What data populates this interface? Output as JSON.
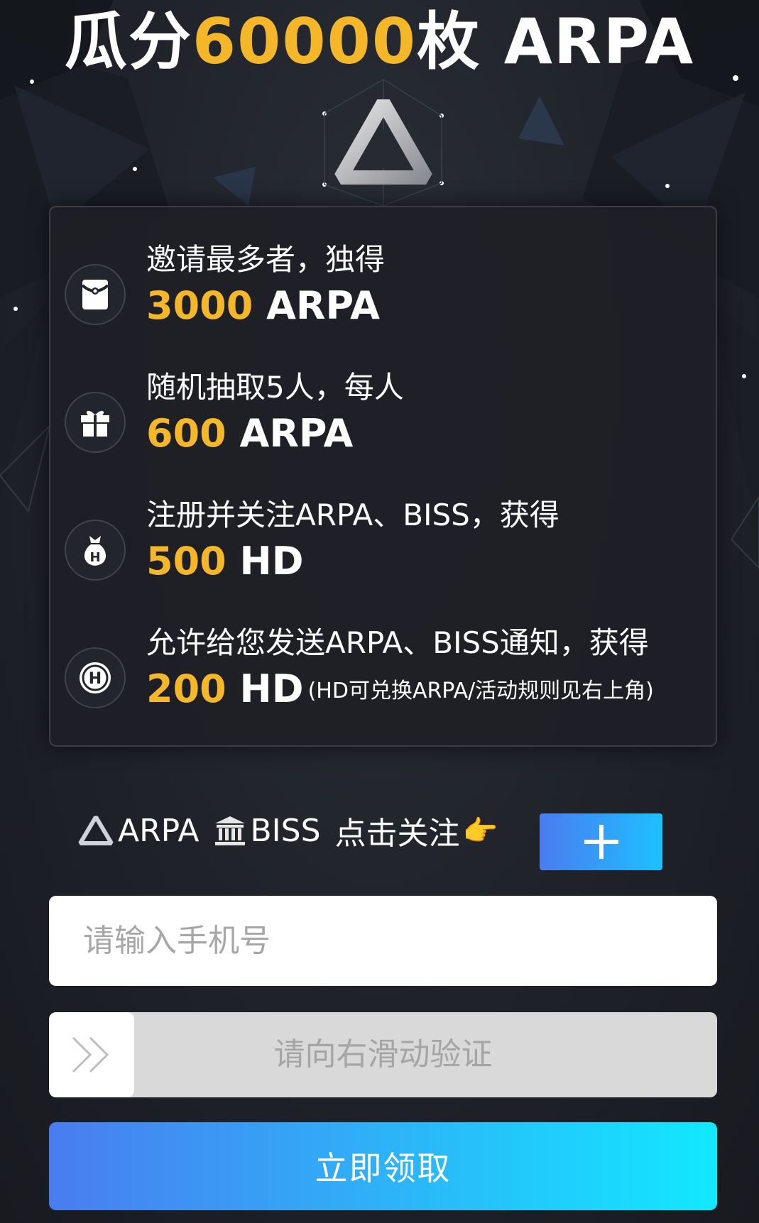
{
  "header": {
    "title_prefix": "瓜分",
    "title_amount": "60000",
    "title_suffix": "枚 ARPA"
  },
  "rewards": [
    {
      "icon": "red-envelope-icon",
      "description": "邀请最多者，独得",
      "amount": "3000",
      "unit": "ARPA",
      "note": ""
    },
    {
      "icon": "gift-icon",
      "description": "随机抽取5人，每人",
      "amount": "600",
      "unit": "ARPA",
      "note": ""
    },
    {
      "icon": "money-bag-icon",
      "description": "注册并关注ARPA、BISS，获得",
      "amount": "500",
      "unit": "HD",
      "note": ""
    },
    {
      "icon": "hd-coin-icon",
      "description": "允许给您发送ARPA、BISS通知，获得",
      "amount": "200",
      "unit": "HD",
      "note": "(HD可兑换ARPA/活动规则见右上角)"
    }
  ],
  "follow": {
    "brand1": "ARPA",
    "brand2": "BISS",
    "label": "点击关注",
    "pointer": "👉",
    "button_icon": "plus-icon"
  },
  "form": {
    "phone_placeholder": "请输入手机号",
    "slider_text": "请向右滑动验证",
    "slider_icon": "double-chevron-right-icon",
    "submit_label": "立即领取"
  },
  "colors": {
    "accent_gold": "#f5b72a",
    "button_gradient_start": "#4a7cf0",
    "button_gradient_end": "#12e8ff"
  }
}
